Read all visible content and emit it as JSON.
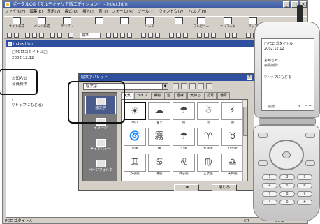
{
  "window": {
    "title": "ポータルCG（マルチキャリア版エディション） - index.htm"
  },
  "menubar": [
    "ファイル(F)",
    "編集(E)",
    "表示(V)",
    "書式(O)",
    "挿入(I)",
    "表(T)",
    "フォーム(M)",
    "ツール(T)",
    "ウィンドウ(W)",
    "ヘルプ(H)"
  ],
  "toolbar": [
    {
      "label": "サイト作成",
      "icon": "site-icon"
    },
    {
      "label": "ページ作成",
      "icon": "page-icon"
    },
    {
      "label": "テンプレ",
      "icon": "template-icon"
    },
    {
      "label": "",
      "icon": "copy-icon"
    },
    {
      "label": "",
      "icon": "doc-icon"
    },
    {
      "label": "ソース",
      "icon": "source-icon"
    },
    {
      "label": "",
      "icon": "preview-icon"
    },
    {
      "label": "プレビュー",
      "icon": "preview2-icon"
    },
    {
      "label": "エンコード",
      "icon": "encode-icon"
    },
    {
      "label": "アップ",
      "icon": "upload-icon"
    }
  ],
  "format_bar": {
    "font_select": "標準"
  },
  "editor": {
    "title": "index.htm",
    "lines": [
      "□PCロゴタイトル□",
      "2002.12.12",
      "",
      "お知らせ",
      "会員制作",
      "",
      "/",
      "▽トップにもどる/"
    ]
  },
  "dialog": {
    "title": "絵文字パレット",
    "select_value": "絵文字",
    "left_items": [
      "絵文字",
      "イメージ",
      "サイドバナー",
      "ページフォルダ"
    ],
    "tabs": [
      "天気",
      "ライフ",
      "乗物",
      "遊",
      "趣味",
      "気持ち",
      "記号",
      "番号"
    ],
    "grid": [
      {
        "glyph": "☀",
        "label": "晴れ"
      },
      {
        "glyph": "☁",
        "label": "曇り"
      },
      {
        "glyph": "☂",
        "label": "雨"
      },
      {
        "glyph": "☃",
        "label": "雪"
      },
      {
        "glyph": "⚡",
        "label": "雷"
      },
      {
        "glyph": "🌀",
        "label": "台風"
      },
      {
        "glyph": "霧",
        "label": "霧"
      },
      {
        "glyph": "☂",
        "label": "小雨"
      },
      {
        "glyph": "♈",
        "label": "牡羊座"
      },
      {
        "glyph": "♉",
        "label": "牡牛座"
      },
      {
        "glyph": "♊",
        "label": "双子座"
      },
      {
        "glyph": "♋",
        "label": "蟹座"
      },
      {
        "glyph": "♌",
        "label": "獅子座"
      },
      {
        "glyph": "♍",
        "label": "乙女座"
      },
      {
        "glyph": "♎",
        "label": "天秤座"
      }
    ],
    "ok_label": "OK",
    "close_label": "閉じる"
  },
  "phone": {
    "lines": [
      "□PCロゴタイトル",
      "2002.12.12",
      "",
      "お知らせ",
      "会員制作",
      "",
      "▽トップにもどる"
    ],
    "soft_left": "戻る",
    "soft_right": "メニュー",
    "keys": [
      "1",
      "2",
      "3",
      "4",
      "5",
      "6",
      "7",
      "8",
      "9",
      "*",
      "0",
      "#"
    ]
  },
  "status": {
    "left": "PCロゴタイトル",
    "mid": "CR",
    "right": "50%"
  },
  "colors": {
    "title_bar": "#3d5aa0",
    "window_bg": "#d4d0c8",
    "dialog_left_bg": "#7b7b7b"
  }
}
